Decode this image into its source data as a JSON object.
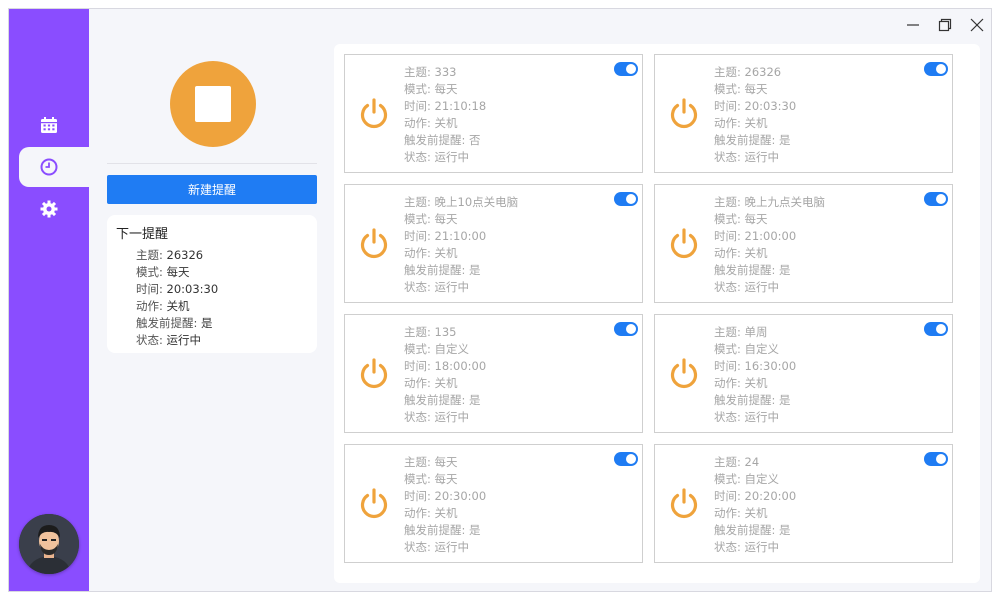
{
  "colors": {
    "sidebar": "#8a4dff",
    "accent": "#1f7cf3",
    "stop": "#efa33c",
    "power": "#efa33c"
  },
  "icons": {
    "nav": [
      "calendar-icon",
      "clock-icon",
      "gear-icon"
    ],
    "window": [
      "minimize-icon",
      "restore-icon",
      "close-icon"
    ],
    "stop": "stop-icon",
    "power": "power-icon"
  },
  "left_panel": {
    "new_button": "新建提醒",
    "next": {
      "title": "下一提醒",
      "lines": [
        {
          "k": "主题: ",
          "v": "26326"
        },
        {
          "k": "模式: ",
          "v": "每天"
        },
        {
          "k": "时间: ",
          "v": "20:03:30"
        },
        {
          "k": "动作: ",
          "v": "关机"
        },
        {
          "k": "触发前提醒: ",
          "v": "是"
        },
        {
          "k": "状态: ",
          "v": "运行中"
        }
      ]
    }
  },
  "cards": [
    {
      "enabled": true,
      "lines": [
        "主题: 333",
        "模式: 每天",
        "时间: 21:10:18",
        "动作: 关机",
        "触发前提醒: 否",
        "状态: 运行中"
      ]
    },
    {
      "enabled": true,
      "lines": [
        "主题: 26326",
        "模式: 每天",
        "时间: 20:03:30",
        "动作: 关机",
        "触发前提醒: 是",
        "状态: 运行中"
      ]
    },
    {
      "enabled": true,
      "lines": [
        "主题: 晚上10点关电脑",
        "模式: 每天",
        "时间: 21:10:00",
        "动作: 关机",
        "触发前提醒: 是",
        "状态: 运行中"
      ]
    },
    {
      "enabled": true,
      "lines": [
        "主题: 晚上九点关电脑",
        "模式: 每天",
        "时间: 21:00:00",
        "动作: 关机",
        "触发前提醒: 是",
        "状态: 运行中"
      ]
    },
    {
      "enabled": true,
      "lines": [
        "主题: 135",
        "模式: 自定义",
        "时间: 18:00:00",
        "动作: 关机",
        "触发前提醒: 是",
        "状态: 运行中"
      ]
    },
    {
      "enabled": true,
      "lines": [
        "主题: 单周",
        "模式: 自定义",
        "时间: 16:30:00",
        "动作: 关机",
        "触发前提醒: 是",
        "状态: 运行中"
      ]
    },
    {
      "enabled": true,
      "lines": [
        "主题: 每天",
        "模式: 每天",
        "时间: 20:30:00",
        "动作: 关机",
        "触发前提醒: 是",
        "状态: 运行中"
      ]
    },
    {
      "enabled": true,
      "lines": [
        "主题: 24",
        "模式: 自定义",
        "时间: 20:20:00",
        "动作: 关机",
        "触发前提醒: 是",
        "状态: 运行中"
      ]
    }
  ]
}
